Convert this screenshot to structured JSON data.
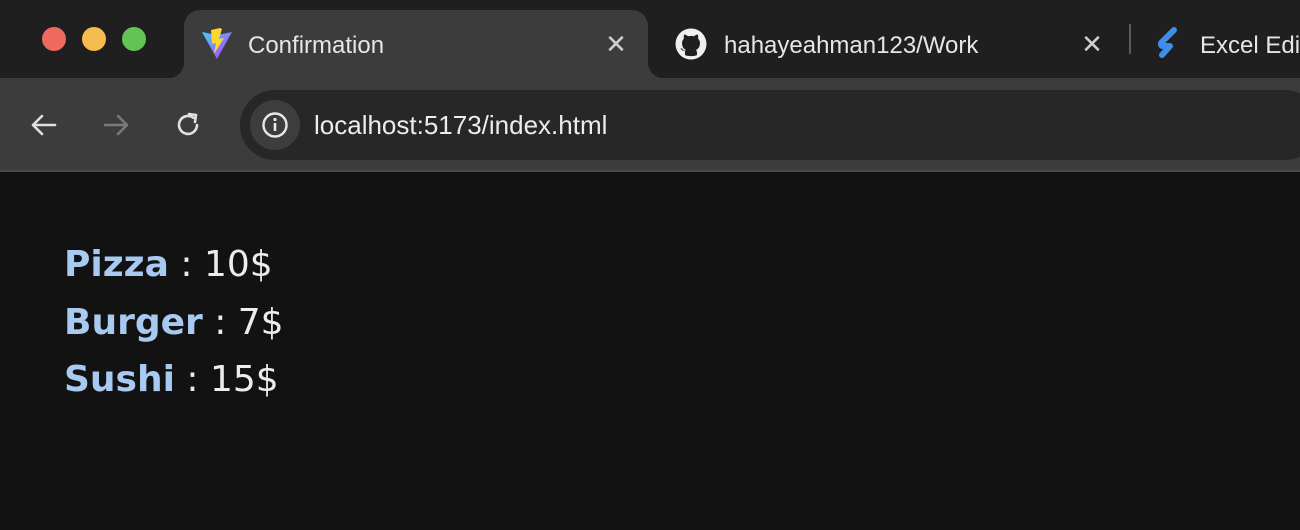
{
  "window": {
    "traffic_lights": [
      "close",
      "minimize",
      "zoom"
    ]
  },
  "tabs": [
    {
      "title": "Confirmation",
      "icon": "vite-icon",
      "active": true,
      "close_label": "✕"
    },
    {
      "title": "hahayeahman123/Work",
      "icon": "github-icon",
      "active": false,
      "close_label": "✕"
    },
    {
      "title": "Excel Edi",
      "icon": "app-s-icon",
      "active": false
    }
  ],
  "toolbar": {
    "back_icon": "back-arrow-icon",
    "forward_icon": "forward-arrow-icon",
    "reload_icon": "reload-icon",
    "site_info_icon": "info-icon",
    "url": "localhost:5173/index.html"
  },
  "page": {
    "items": [
      {
        "name": "Pizza",
        "separator": " : ",
        "price": "10$"
      },
      {
        "name": "Burger",
        "separator": " : ",
        "price": "7$"
      },
      {
        "name": "Sushi",
        "separator": " : ",
        "price": "15$"
      }
    ]
  },
  "colors": {
    "page_background": "#121212",
    "item_name": "#a8c9f0",
    "item_text": "#ececec",
    "toolbar": "#3c3c3c",
    "tabstrip": "#1f1f1f"
  }
}
